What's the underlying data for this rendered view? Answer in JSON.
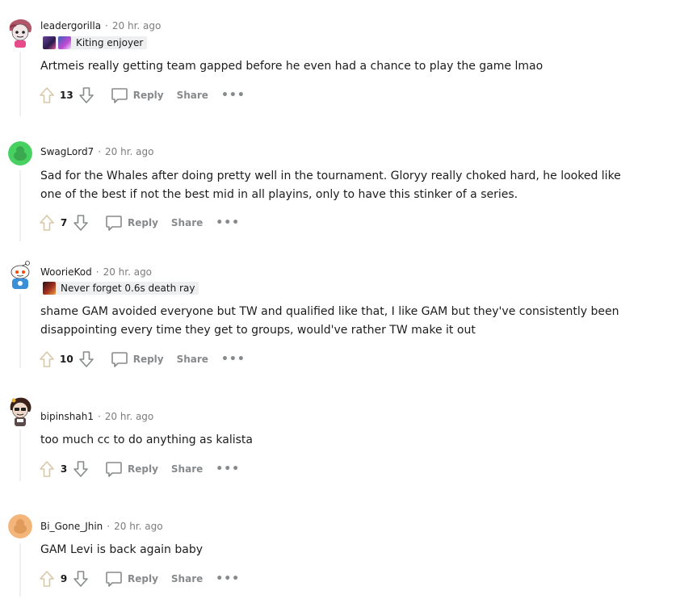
{
  "colors": {
    "meta_text": "#7c7c7c",
    "action_text": "#878a8c",
    "thread_line": "#edeff1",
    "flair_bg": "#edeff1"
  },
  "action_labels": {
    "reply": "Reply",
    "share": "Share",
    "more": "•••"
  },
  "comments": [
    {
      "username": "leadergorilla",
      "time": "20 hr. ago",
      "flair": "Kiting enjoyer",
      "lines": [
        "Artmeis really getting team gapped before he even had a chance to play the game lmao"
      ],
      "score": "13",
      "avatar": "snoo-pink-hair-icon"
    },
    {
      "username": "SwagLord7",
      "time": "20 hr. ago",
      "lines": [
        "Sad for the Whales after doing pretty well in the tournament. Gloryy really choked hard, he looked like",
        "one of the best if not the best mid in all playins, only to have this stinker of a series."
      ],
      "score": "7",
      "avatar": "default-green-avatar-icon"
    },
    {
      "username": "WoorieKod",
      "time": "20 hr. ago",
      "flair": "Never forget 0.6s death ray",
      "lines": [
        "shame GAM avoided everyone but TW and qualified like that, I like GAM but they've consistently been",
        "disappointing every time they get to groups, would've rather TW make it out"
      ],
      "score": "10",
      "avatar": "snoo-blue-icon"
    },
    {
      "username": "bipinshah1",
      "time": "20 hr. ago",
      "lines": [
        "too much cc to do anything as kalista"
      ],
      "score": "3",
      "avatar": "snoo-brown-hair-icon"
    },
    {
      "username": "Bi_Gone_Jhin",
      "time": "20 hr. ago",
      "lines": [
        "GAM Levi is back again baby"
      ],
      "score": "9",
      "avatar": "default-orange-avatar-icon"
    }
  ]
}
